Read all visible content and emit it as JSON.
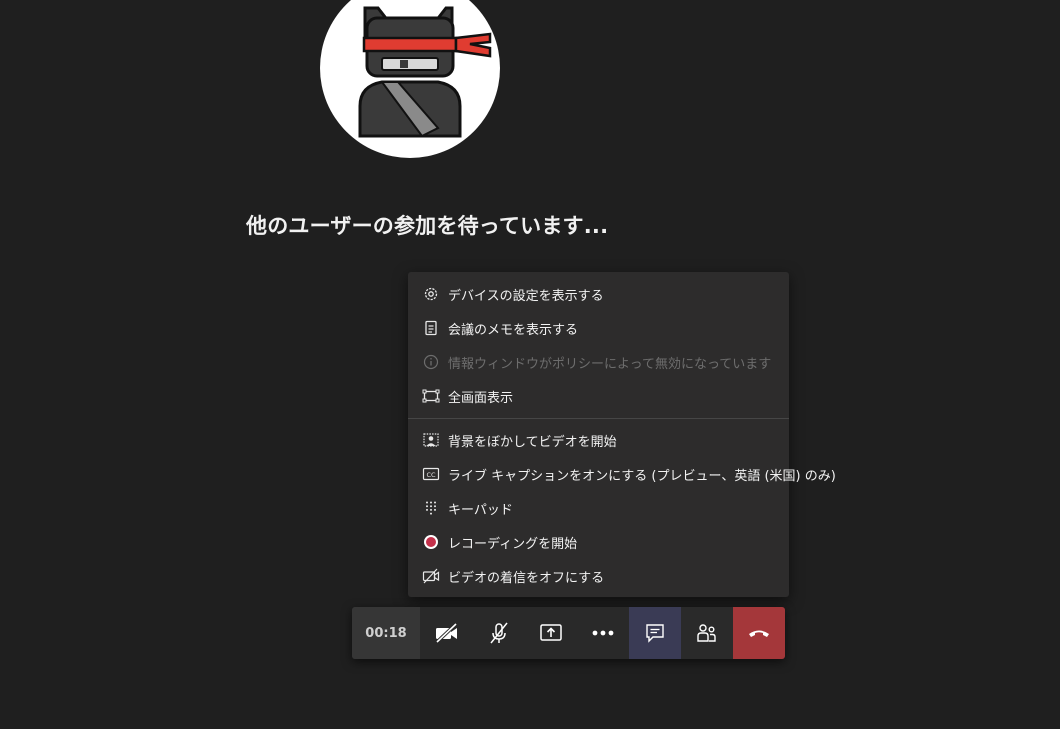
{
  "meeting": {
    "waiting_message": "他のユーザーの参加を待っています..."
  },
  "more_menu": {
    "items": [
      {
        "label": "デバイスの設定を表示する",
        "icon": "gear-icon",
        "enabled": true
      },
      {
        "label": "会議のメモを表示する",
        "icon": "notes-icon",
        "enabled": true
      },
      {
        "label": "情報ウィンドウがポリシーによって無効になっています",
        "icon": "info-icon",
        "enabled": false
      },
      {
        "label": "全画面表示",
        "icon": "fullscreen-icon",
        "enabled": true
      },
      {
        "label": "背景をぼかしてビデオを開始",
        "icon": "blur-background-icon",
        "enabled": true
      },
      {
        "label": "ライブ キャプションをオンにする (プレビュー、英語 (米国) のみ)",
        "icon": "closed-captions-icon",
        "enabled": true
      },
      {
        "label": "キーパッド",
        "icon": "keypad-icon",
        "enabled": true
      },
      {
        "label": "レコーディングを開始",
        "icon": "record-icon",
        "enabled": true
      },
      {
        "label": "ビデオの着信をオフにする",
        "icon": "video-off-icon",
        "enabled": true
      }
    ]
  },
  "toolbar": {
    "timer": "00:18",
    "buttons": [
      "camera-off-icon",
      "mic-off-icon",
      "share-screen-icon",
      "more-options-icon",
      "chat-icon",
      "participants-icon",
      "hang-up-icon"
    ]
  },
  "colors": {
    "background": "#1f1f1f",
    "menu_bg": "#2d2c2c",
    "chat_active_bg": "#3a3b55",
    "hangup_red": "#a4373a",
    "record_red": "#c4314b",
    "headband_red": "#e03c31"
  }
}
